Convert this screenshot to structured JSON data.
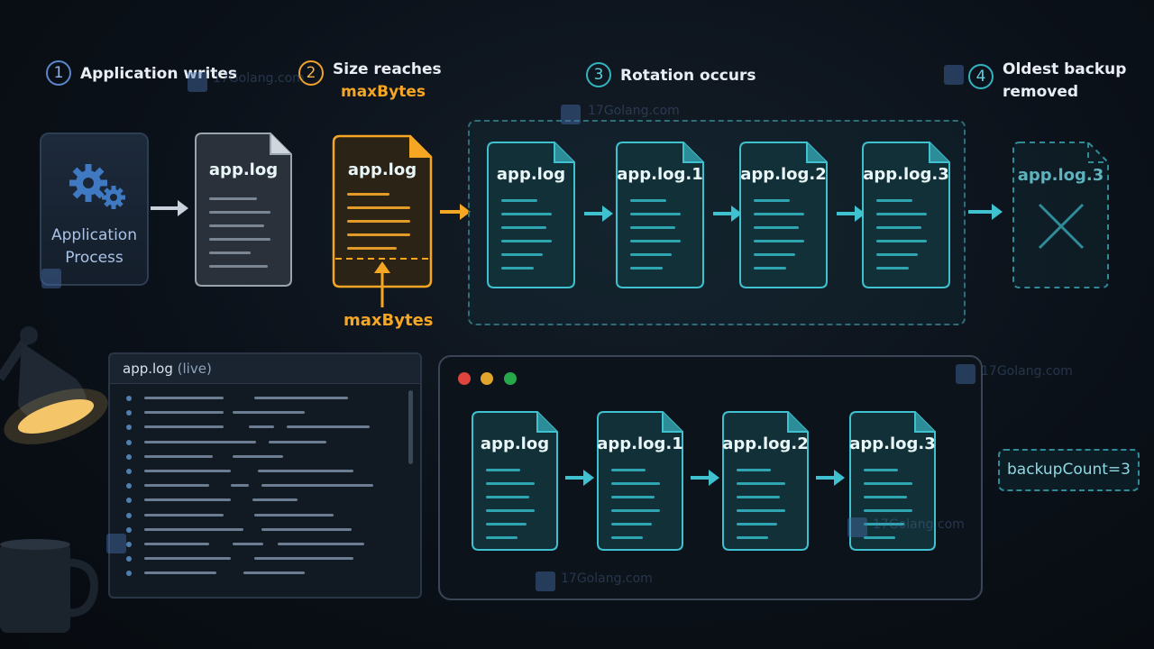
{
  "steps": [
    {
      "num": "1",
      "text": "Application writes"
    },
    {
      "num": "2",
      "text": "Size reaches",
      "accent": "maxBytes"
    },
    {
      "num": "3",
      "text": "Rotation occurs"
    },
    {
      "num": "4",
      "line1": "Oldest backup",
      "line2": "removed"
    }
  ],
  "process": {
    "line1": "Application",
    "line2": "Process",
    "icon": "gears-icon"
  },
  "docs_top": {
    "written": "app.log",
    "full": "app.log",
    "threshold_label": "maxBytes",
    "rotated": [
      "app.log",
      "app.log.1",
      "app.log.2",
      "app.log.3"
    ],
    "removed": "app.log.3"
  },
  "panel": {
    "title": "app.log",
    "subtitle": "(live)"
  },
  "window_docs": [
    "app.log",
    "app.log.1",
    "app.log.2",
    "app.log.3"
  ],
  "badge": "backupCount=3",
  "watermark": "17Golang.com",
  "colors": {
    "orange": "#f5a623",
    "teal": "#3fc1cf",
    "gray": "#c9d2dc",
    "blue": "#5b86c9"
  }
}
